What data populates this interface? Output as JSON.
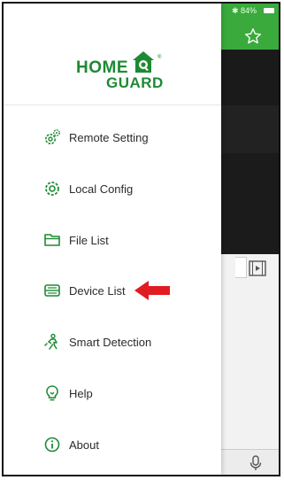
{
  "status": {
    "text": "✱ 84%"
  },
  "brand": {
    "line1": "HOME",
    "line2": "GUARD",
    "registered": "®"
  },
  "menu": [
    {
      "label": "Remote Setting",
      "icon": "remote-setting-gear-icon"
    },
    {
      "label": "Local Config",
      "icon": "local-config-gear-icon"
    },
    {
      "label": "File List",
      "icon": "folder-icon"
    },
    {
      "label": "Device List",
      "icon": "device-list-icon"
    },
    {
      "label": "Smart Detection",
      "icon": "smart-detection-icon"
    },
    {
      "label": "Help",
      "icon": "lightbulb-icon"
    },
    {
      "label": "About",
      "icon": "info-icon"
    }
  ],
  "colors": {
    "brand_green": "#1e8a33",
    "header_green": "#3aaa3c",
    "arrow_red": "#e11b22"
  }
}
